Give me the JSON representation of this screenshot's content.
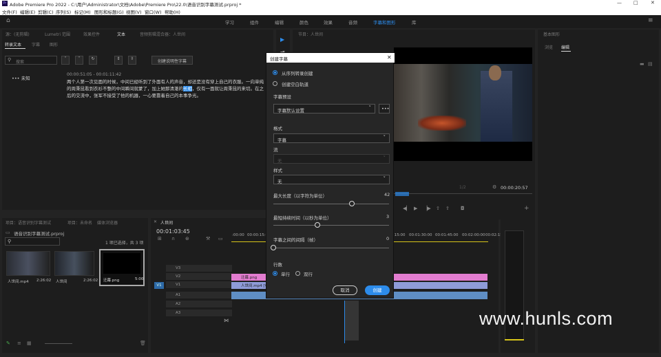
{
  "window": {
    "app_title": "Adobe Premiere Pro 2022 - C:\\用户\\Administrator\\文档\\Adobe\\Premiere Pro\\22.0\\语音识别字幕测试.prproj *"
  },
  "menu": [
    "文件(F)",
    "编辑(E)",
    "剪辑(C)",
    "序列(S)",
    "标记(M)",
    "图形和标题(G)",
    "视图(V)",
    "窗口(W)",
    "帮助(H)"
  ],
  "workspaces": [
    "学习",
    "组件",
    "编辑",
    "颜色",
    "效果",
    "音频",
    "字幕和图形",
    "库"
  ],
  "active_workspace": "字幕和图形",
  "text_panel": {
    "top_tabs": [
      "源：(无剪辑)",
      "Lumetri 范围",
      "效果控件",
      "文本",
      "音频剪辑混合器：人世间"
    ],
    "tabs": [
      "转录文本",
      "字幕",
      "图形"
    ],
    "search_placeholder": "搜索",
    "create_captions_button": "创建说明性字幕",
    "speaker": "未知",
    "timecode": "00:00:51:05 - 00:01:11:42",
    "transcript": "两个人第一次见面的时候，中间已经听到了外面有人的声音，却还是没有穿上自己的衣服。一向单纯的周秉昆看到衣衫不整的中间瞬间就蒙了，加上她那清澈的长相，仅有一面就让周秉昆的来切。在之后的交流中，张军不接受了他的机器，一心要靠着自己的本事争光。",
    "highlight": "长相"
  },
  "program_panel": {
    "title": "节目：人世间",
    "fit": "1/2",
    "timecode": "00:00:20:57"
  },
  "right_panel": {
    "title": "基本图形",
    "tabs": [
      "浏览",
      "编辑"
    ]
  },
  "project_panel": {
    "tabs": [
      "项目：语音识别字幕测试",
      "项目：未命名",
      "媒体浏览器"
    ],
    "file": "语音识别字幕测试.prproj",
    "selection": "1 项已选择，共 3 项",
    "items": [
      {
        "name": "人世间.mp4",
        "duration": "2:26:02"
      },
      {
        "name": "人世间",
        "duration": "2:26:02"
      },
      {
        "name": "迁幕.png",
        "duration": "5:00"
      }
    ]
  },
  "timeline": {
    "title": "人世间",
    "timecode": "00:01:03:45",
    "ruler": [
      ":00:00",
      "00:00:15:00",
      "00:01:15:00",
      "00:01:30:00",
      "00:01:45:00",
      "00:02:00:00",
      "00:02:15:00"
    ],
    "tracks": [
      "V3",
      "V2",
      "V1",
      "A1",
      "A2",
      "A3"
    ],
    "source_label": "V1",
    "clips": [
      "迁幕.png",
      "人世间.mp4 [V]"
    ]
  },
  "dialog": {
    "title": "创建字幕",
    "option_transcript": "从序列转录创建",
    "option_blank": "创建空白轨道",
    "preset_label": "字幕预设",
    "preset_value": "字幕默认设置",
    "format_label": "格式",
    "format_value": "字幕",
    "stream_label": "流",
    "stream_value": "无",
    "style_label": "样式",
    "style_value": "无",
    "max_length_label": "最大长度（以字符为单位）",
    "max_length_value": "42",
    "max_length_fraction": 0.68,
    "min_duration_label": "最短持续时间（以秒为单位）",
    "min_duration_value": "3",
    "min_duration_fraction": 0.38,
    "gap_label": "字幕之间的间隔（帧）",
    "gap_value": "0",
    "gap_fraction": 0.0,
    "lines_label": "行数",
    "single_line": "单行",
    "double_line": "双行",
    "cancel": "取消",
    "create": "创建"
  },
  "watermark": "www.hunls.com",
  "colors": {
    "accent": "#2d8ceb",
    "graphic_clip": "#e27ccf",
    "video_clip": "#8e9bd8",
    "audio_clip": "#5f8ec4"
  }
}
